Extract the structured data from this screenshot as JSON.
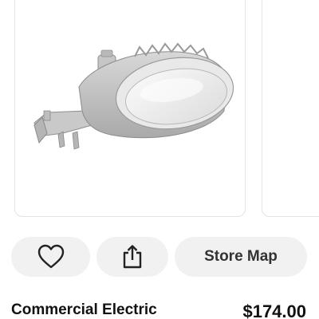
{
  "product": {
    "name": "Commercial Electric",
    "price": "$174.00"
  },
  "actions": {
    "favorite_icon": "heart-icon",
    "share_icon": "share-icon",
    "store_map_label": "Store Map"
  },
  "colors": {
    "button_bg": "#f1f1f1",
    "text_dark": "#111111",
    "card_border": "#e3e3e3"
  }
}
